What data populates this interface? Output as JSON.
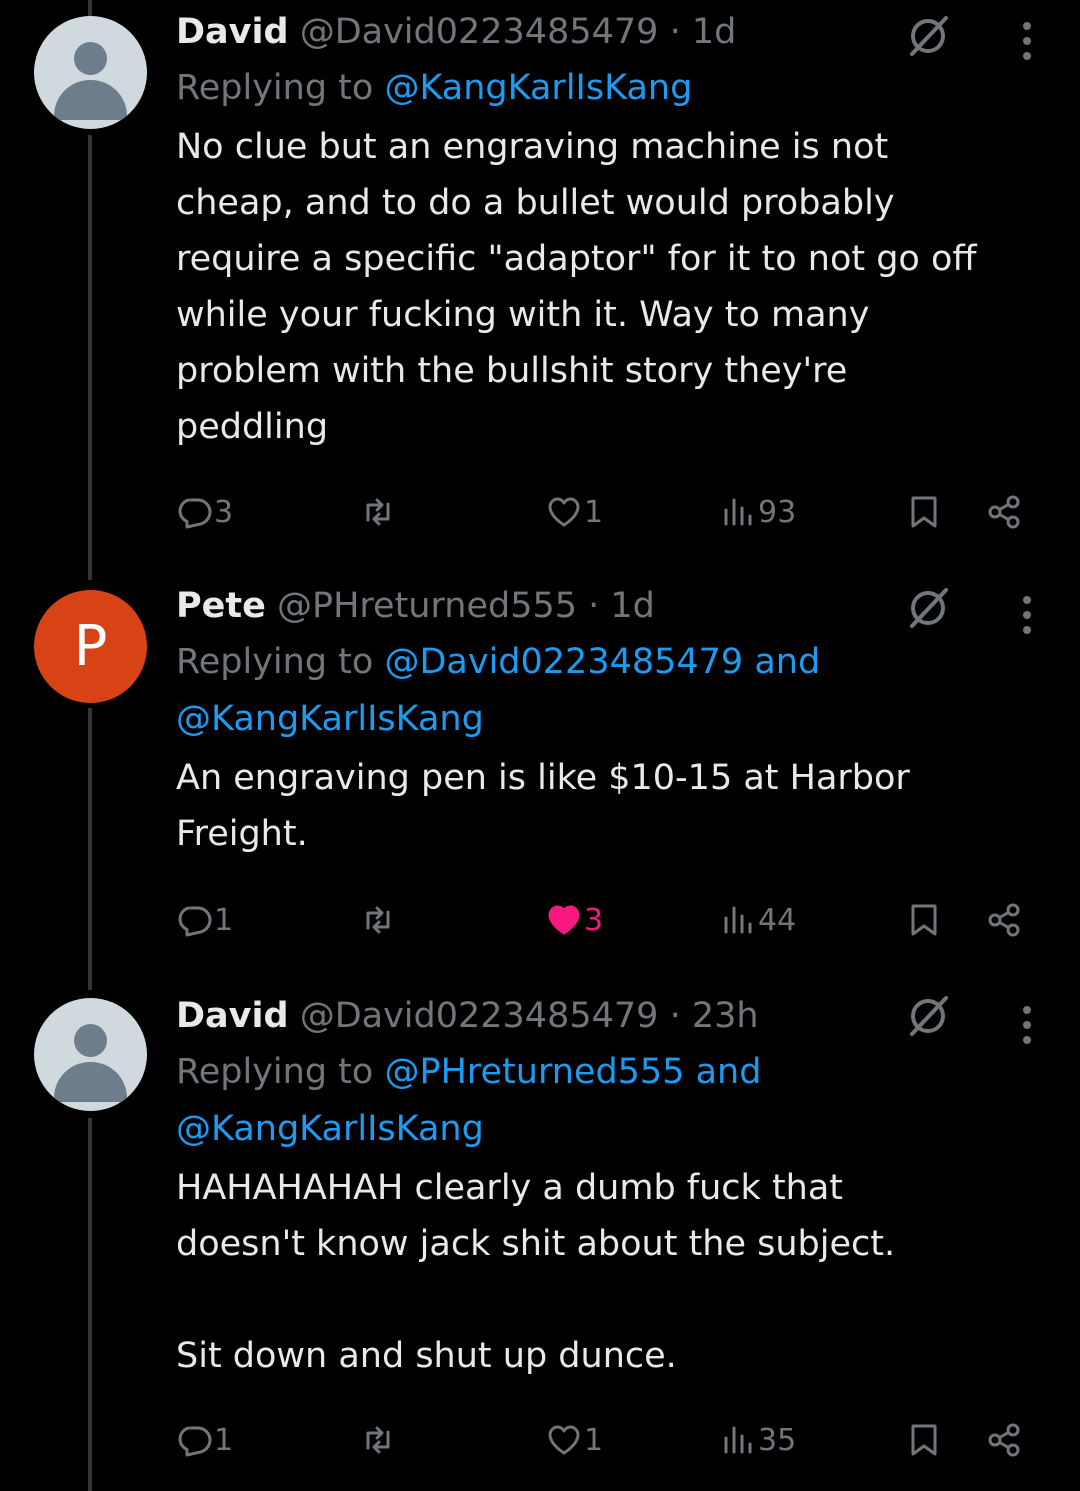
{
  "tweets": [
    {
      "name": "David",
      "handle": "@David0223485479",
      "time": "· 1d",
      "replying_prefix": "Replying to",
      "replying_to": "@KangKarlIsKang",
      "replying_to2": "",
      "text": "No clue but an engraving machine is not\ncheap, and to do a bullet would probably\nrequire a specific \"adaptor\" for it to not go off\nwhile your fucking with it. Way to many\nproblem with the bullshit story they're\npeddling",
      "avatar_letter": "",
      "replies": "3",
      "reposts": "",
      "likes": "1",
      "views": "93"
    },
    {
      "name": "Pete",
      "handle": "@PHreturned555",
      "time": "· 1d",
      "replying_prefix": "Replying to",
      "replying_to": "@David0223485479 and",
      "replying_to2": "@KangKarlIsKang",
      "text": "An engraving pen is like $10-15 at Harbor\nFreight.",
      "avatar_letter": "P",
      "replies": "1",
      "reposts": "",
      "likes": "3",
      "views": "44"
    },
    {
      "name": "David",
      "handle": "@David0223485479",
      "time": "· 23h",
      "replying_prefix": "Replying to",
      "replying_to": "@PHreturned555 and",
      "replying_to2": "@KangKarlIsKang",
      "text": "HAHAHAHAH clearly a dumb fuck that\ndoesn't know jack shit about the subject.\n\nSit down and shut up dunce.",
      "avatar_letter": "",
      "replies": "1",
      "reposts": "",
      "likes": "1",
      "views": "35"
    }
  ],
  "colors": {
    "background": "#000000",
    "text": "#e7e9ea",
    "secondary": "#71767b",
    "mention": "#1d9bf0",
    "like_active": "#f91880"
  },
  "icons": [
    "reply-icon",
    "repost-icon",
    "like-icon",
    "views-icon",
    "bookmark-icon",
    "share-icon",
    "more-icon",
    "muted-icon"
  ]
}
